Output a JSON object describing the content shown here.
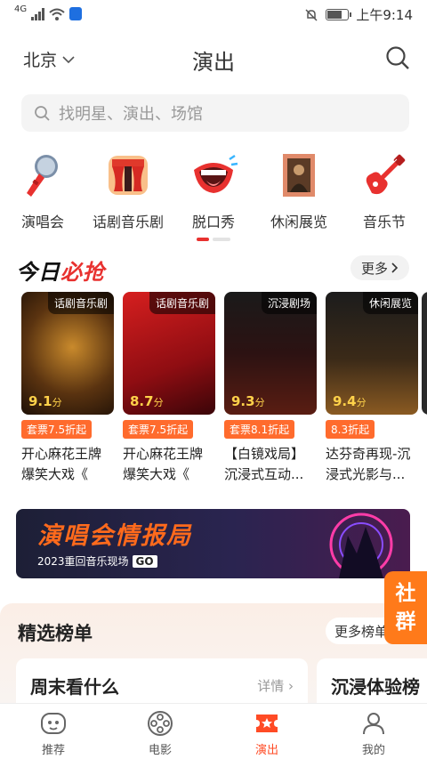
{
  "status": {
    "network": "4G",
    "time": "上午9:14"
  },
  "header": {
    "city": "北京",
    "title": "演出"
  },
  "search": {
    "placeholder": "找明星、演出、场馆"
  },
  "categories": [
    {
      "label": "演唱会",
      "icon": "microphone-icon"
    },
    {
      "label": "话剧音乐剧",
      "icon": "theater-curtain-icon"
    },
    {
      "label": "脱口秀",
      "icon": "laughing-mouth-icon"
    },
    {
      "label": "休闲展览",
      "icon": "painting-frame-icon"
    },
    {
      "label": "音乐节",
      "icon": "electric-guitar-icon"
    }
  ],
  "deals": {
    "logo_a": "今日",
    "logo_b": "必抢",
    "more": "更多",
    "cards": [
      {
        "tag": "话剧音乐剧",
        "score": "9.1",
        "unit": "分",
        "badge": "套票7.5折起",
        "title_line1": "开心麻花王牌",
        "title_line2": "爆笑大戏《"
      },
      {
        "tag": "话剧音乐剧",
        "score": "8.7",
        "unit": "分",
        "badge": "套票7.5折起",
        "title_line1": "开心麻花王牌",
        "title_line2": "爆笑大戏《"
      },
      {
        "tag": "沉浸剧场",
        "score": "9.3",
        "unit": "分",
        "badge": "套票8.1折起",
        "title_line1": "【白镜戏局】",
        "title_line2": "沉浸式互动..."
      },
      {
        "tag": "休闲展览",
        "score": "9.4",
        "unit": "分",
        "badge": "8.3折起",
        "title_line1": "达芬奇再现-沉",
        "title_line2": "浸式光影与..."
      }
    ]
  },
  "banner": {
    "title": "演唱会情报局",
    "subtitle": "2023重回音乐现场",
    "cta": "GO"
  },
  "side_pill": {
    "line1": "社",
    "line2": "群"
  },
  "ranking": {
    "title": "精选榜单",
    "more": "更多榜单",
    "cards": [
      {
        "title": "周末看什么",
        "detail": "详情"
      },
      {
        "title": "沉浸体验榜"
      }
    ]
  },
  "tabs": [
    {
      "label": "推荐",
      "icon": "robot-face-icon",
      "active": false
    },
    {
      "label": "电影",
      "icon": "film-reel-icon",
      "active": false
    },
    {
      "label": "演出",
      "icon": "ticket-icon",
      "active": true
    },
    {
      "label": "我的",
      "icon": "person-icon",
      "active": false
    }
  ],
  "colors": {
    "accent": "#ff4b25",
    "badge": "#ff6b2d",
    "score": "#ffd24a"
  }
}
